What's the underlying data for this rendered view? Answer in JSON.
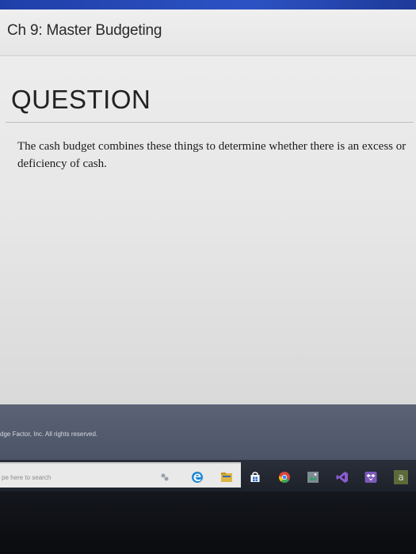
{
  "header": {
    "title": "Ch 9: Master Budgeting"
  },
  "main": {
    "section_heading": "QUESTION",
    "question_text": "The cash budget combines these things to determine whether there is an excess or deficiency of cash."
  },
  "footer": {
    "copyright": "dge Factor, Inc. All rights reserved."
  },
  "taskbar": {
    "search_placeholder": "pe here to search",
    "icons": [
      "task-view-icon",
      "edge-browser-icon",
      "file-explorer-icon",
      "store-icon",
      "chrome-icon",
      "photo-app-icon",
      "visual-studio-icon",
      "dropbox-icon",
      "app-icon"
    ],
    "last_icon_glyph": "a"
  },
  "colors": {
    "header_bg": "#e9e9e9",
    "content_bg": "#e7e7e7",
    "footer_band": "#545c6e",
    "taskbar_bg": "#22262f",
    "bezel": "#0a0b0e",
    "top_bar": "#2c52c4"
  }
}
